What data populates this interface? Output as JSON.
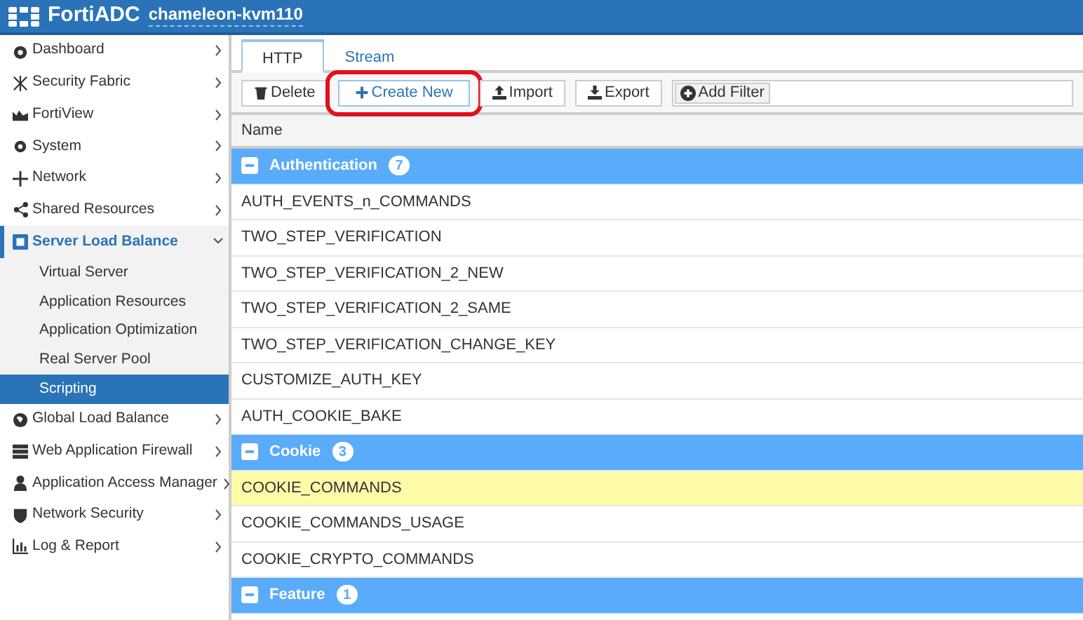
{
  "header": {
    "product": "FortiADC",
    "hostname": "chameleon-kvm110"
  },
  "sidebar": {
    "items": [
      {
        "label": "Dashboard",
        "expanded": false,
        "selected": false
      },
      {
        "label": "Security Fabric",
        "expanded": false,
        "selected": false
      },
      {
        "label": "FortiView",
        "expanded": false,
        "selected": false
      },
      {
        "label": "System",
        "expanded": false,
        "selected": false
      },
      {
        "label": "Network",
        "expanded": false,
        "selected": false
      },
      {
        "label": "Shared Resources",
        "expanded": false,
        "selected": false
      },
      {
        "label": "Server Load Balance",
        "expanded": true,
        "selected": true,
        "children": [
          {
            "label": "Virtual Server",
            "selected": false
          },
          {
            "label": "Application Resources",
            "selected": false
          },
          {
            "label": "Application Optimization",
            "selected": false
          },
          {
            "label": "Real Server Pool",
            "selected": false
          },
          {
            "label": "Scripting",
            "selected": true
          }
        ]
      },
      {
        "label": "Global Load Balance",
        "expanded": false,
        "selected": false
      },
      {
        "label": "Web Application Firewall",
        "expanded": false,
        "selected": false
      },
      {
        "label": "Application Access Manager",
        "expanded": false,
        "selected": false
      },
      {
        "label": "Network Security",
        "expanded": false,
        "selected": false
      },
      {
        "label": "Log & Report",
        "expanded": false,
        "selected": false
      }
    ]
  },
  "tabs": [
    {
      "label": "HTTP",
      "selected": true
    },
    {
      "label": "Stream",
      "selected": false
    }
  ],
  "toolbar": {
    "buttons": [
      {
        "label": "Delete",
        "kind": "delete",
        "highlighted": false
      },
      {
        "label": "Create New",
        "kind": "create",
        "highlighted": true
      },
      {
        "label": "Import",
        "kind": "import",
        "highlighted": false
      },
      {
        "label": "Export",
        "kind": "export",
        "highlighted": false
      }
    ],
    "filter": "Add Filter"
  },
  "table": {
    "columns": [
      "Name"
    ],
    "groups": [
      {
        "name": "Authentication",
        "count": "7",
        "expanded": true,
        "rows": [
          {
            "name": "AUTH_EVENTS_n_COMMANDS",
            "selected": false
          },
          {
            "name": "TWO_STEP_VERIFICATION",
            "selected": false
          },
          {
            "name": "TWO_STEP_VERIFICATION_2_NEW",
            "selected": false
          },
          {
            "name": "TWO_STEP_VERIFICATION_2_SAME",
            "selected": false
          },
          {
            "name": "TWO_STEP_VERIFICATION_CHANGE_KEY",
            "selected": false
          },
          {
            "name": "CUSTOMIZE_AUTH_KEY",
            "selected": false
          },
          {
            "name": "AUTH_COOKIE_BAKE",
            "selected": false
          }
        ]
      },
      {
        "name": "Cookie",
        "count": "3",
        "expanded": true,
        "rows": [
          {
            "name": "COOKIE_COMMANDS",
            "selected": true
          },
          {
            "name": "COOKIE_COMMANDS_USAGE",
            "selected": false
          },
          {
            "name": "COOKIE_CRYPTO_COMMANDS",
            "selected": false
          }
        ]
      },
      {
        "name": "Feature",
        "count": "1",
        "expanded": true
      }
    ]
  }
}
